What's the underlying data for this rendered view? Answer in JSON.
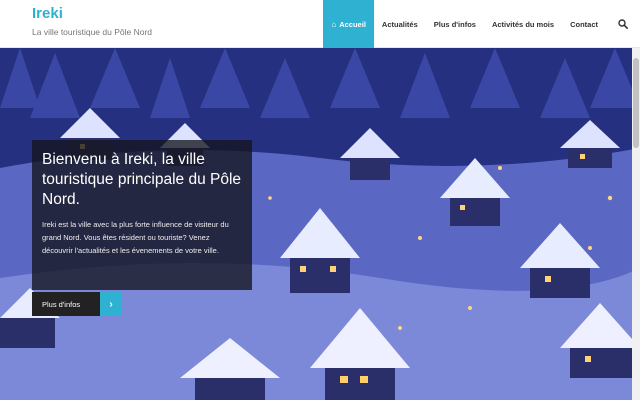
{
  "brand": {
    "title": "Ireki",
    "subtitle": "La ville touristique du Pôle Nord"
  },
  "nav": {
    "items": [
      {
        "label": "Accueil",
        "active": true
      },
      {
        "label": "Actualités"
      },
      {
        "label": "Plus d'infos"
      },
      {
        "label": "Activités du mois"
      },
      {
        "label": "Contact"
      }
    ],
    "search_icon": "search-icon"
  },
  "hero": {
    "title": "Bienvenu à Ireki, la ville touristique principale du Pôle Nord.",
    "text": "Ireki est la ville avec la plus forte influence de visiteur du grand Nord. Vous êtes résident ou touriste? Venez découvrir l'actualités et les évenements de votre ville.",
    "cta_label": "Plus d'infos",
    "cta_icon": "chevron-right-icon"
  },
  "colors": {
    "accent": "#2fb1d1",
    "caption_bg": "#14141e",
    "snow_scene": "#2f3590"
  }
}
